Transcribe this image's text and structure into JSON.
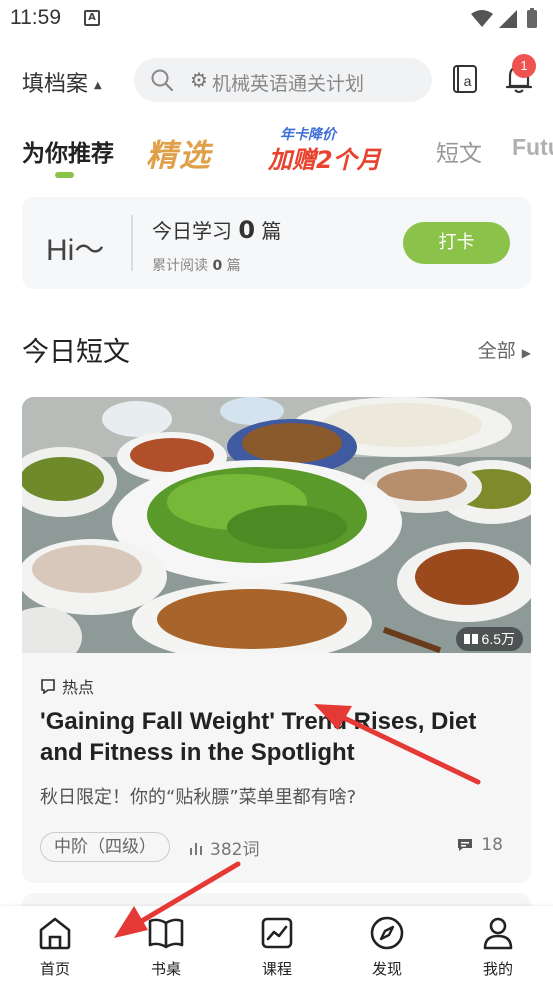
{
  "status_bar": {
    "time": "11:59",
    "app_badge": "A",
    "icons": [
      "wifi-icon",
      "signal-icon",
      "battery-icon"
    ]
  },
  "header": {
    "plan_name": "填档案",
    "search_placeholder": "机械英语通关计划",
    "notification_count": "1"
  },
  "tabs": {
    "active": "为你推荐",
    "jingxuan": "精选",
    "promo_top": "年卡降价",
    "promo_main": "加赠2个月",
    "duanwen": "短文",
    "future": "Futu"
  },
  "study_card": {
    "greeting": "Hi～",
    "today_prefix": "今日学习",
    "today_count": "0",
    "today_unit": "篇",
    "total_prefix": "累计阅读",
    "total_count": "0",
    "total_unit": "篇",
    "checkin_label": "打卡"
  },
  "section": {
    "title": "今日短文",
    "all_label": "全部"
  },
  "article": {
    "views": "6.5万",
    "category": "热点",
    "title": "'Gaining Fall Weight' Trend Rises, Diet and Fitness in the Spotlight",
    "subtitle": "秋日限定！你的“贴秋膘”菜单里都有啥?",
    "level": "中阶（四级）",
    "word_count": "382词",
    "comment_count": "18"
  },
  "bottom_nav": [
    {
      "label": "首页",
      "icon": "home-icon"
    },
    {
      "label": "书桌",
      "icon": "book-icon"
    },
    {
      "label": "课程",
      "icon": "course-chart-icon"
    },
    {
      "label": "发现",
      "icon": "compass-icon"
    },
    {
      "label": "我的",
      "icon": "profile-icon"
    }
  ],
  "colors": {
    "accent": "#8bc34a",
    "badge": "#ef5350",
    "arrow": "#e53935"
  }
}
